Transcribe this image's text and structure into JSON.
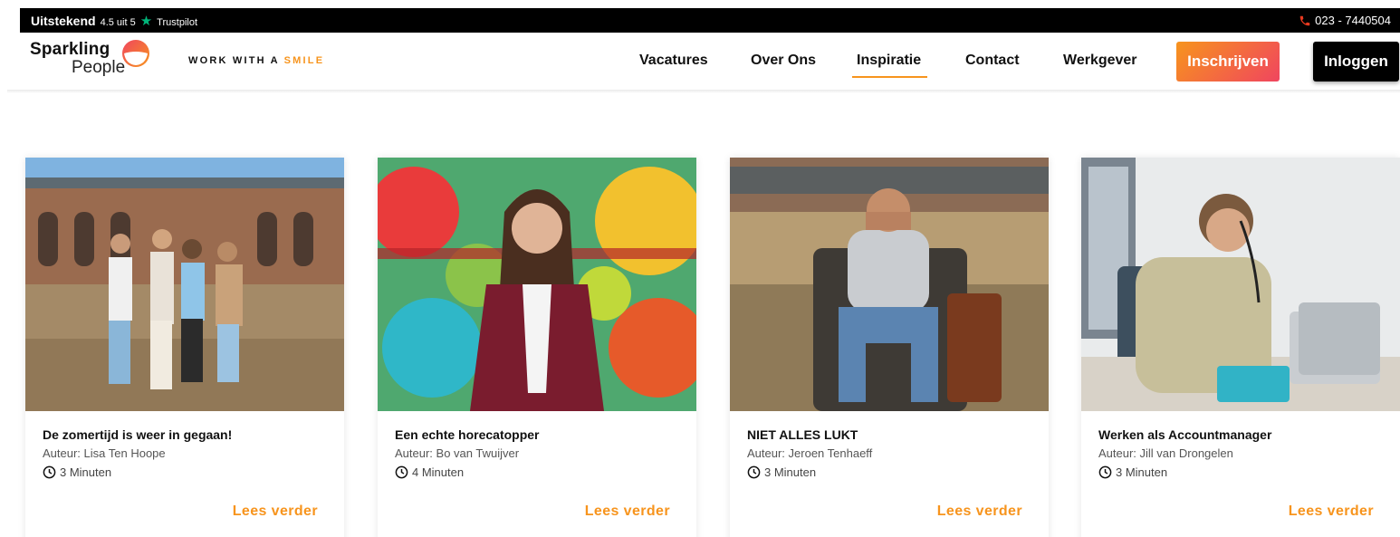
{
  "topbar": {
    "rating_word": "Uitstekend",
    "score": "4.5 uit 5",
    "brand": "Trustpilot",
    "phone": "023 - 7440504",
    "icons": {
      "star": "star-icon",
      "phone": "phone-icon"
    }
  },
  "header": {
    "logo": {
      "line1": "Sparkling",
      "line2": "People"
    },
    "tagline": {
      "prefix": "WORK WITH A ",
      "highlight": "SMILE"
    },
    "nav": [
      {
        "label": "Vacatures"
      },
      {
        "label": "Over Ons"
      },
      {
        "label": "Inspiratie"
      },
      {
        "label": "Contact"
      },
      {
        "label": "Werkgever"
      }
    ],
    "active_nav": "Inspiratie",
    "register_label": "Inschrijven",
    "login_label": "Inloggen"
  },
  "colors": {
    "accent": "#f7941d",
    "accent_pink": "#f0455f",
    "trustpilot": "#00b67a",
    "topbar_bg": "#000000"
  },
  "articles": [
    {
      "title": "De zomertijd is weer in gegaan!",
      "author": "Auteur: Lisa Ten Hoope",
      "read_time": "3 Minuten",
      "more": "Lees verder"
    },
    {
      "title": "Een echte horecatopper",
      "author": "Auteur: Bo van Twuijver",
      "read_time": "4 Minuten",
      "more": "Lees verder"
    },
    {
      "title": "NIET ALLES LUKT",
      "author": "Auteur: Jeroen Tenhaeff",
      "read_time": "3 Minuten",
      "more": "Lees verder"
    },
    {
      "title": "Werken als Accountmanager",
      "author": "Auteur: Jill van Drongelen",
      "read_time": "3 Minuten",
      "more": "Lees verder"
    }
  ]
}
